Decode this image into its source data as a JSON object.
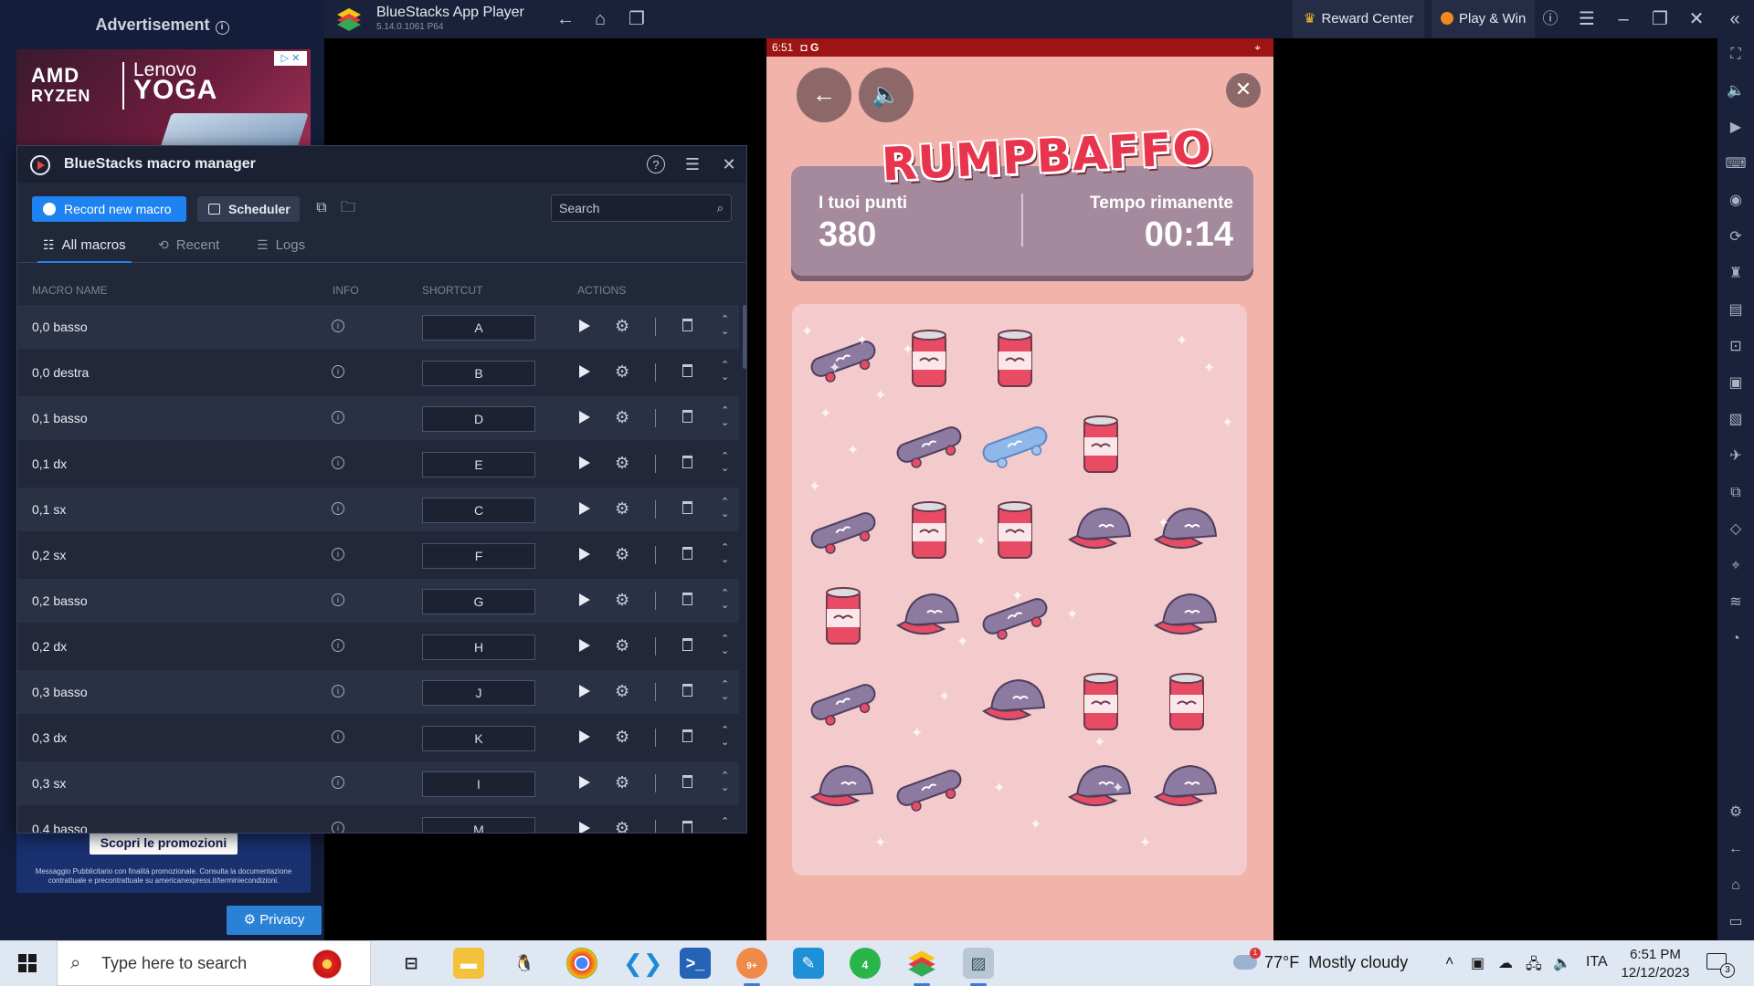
{
  "ad": {
    "header": "Advertisement",
    "info_glyph": "i",
    "banner_brand_1": "AMD",
    "banner_brand_1b": "RYZEN",
    "banner_brand_2": "Lenovo",
    "banner_brand_2b": "YOGA",
    "promo_button": "Scopri le promozioni",
    "promo_disclaimer": "Messaggio Pubblicitario con finalità promozionale. Consulta la documentazione contrattuale e precontrattuale su americanexpress.it/terminiecondizioni.",
    "privacy_button": "Privacy"
  },
  "app": {
    "title": "BlueStacks App Player",
    "version": "5.14.0.1061 P64",
    "reward_center": "Reward Center",
    "play_win": "Play & Win"
  },
  "macro_manager": {
    "title": "BlueStacks macro manager",
    "record_button": "Record new macro",
    "scheduler_button": "Scheduler",
    "search_placeholder": "Search",
    "tabs": [
      {
        "label": "All macros",
        "icon": "list-icon",
        "active": true
      },
      {
        "label": "Recent",
        "icon": "history-icon",
        "active": false
      },
      {
        "label": "Logs",
        "icon": "logs-icon",
        "active": false
      }
    ],
    "columns": {
      "name": "MACRO NAME",
      "info": "INFO",
      "shortcut": "SHORTCUT",
      "actions": "ACTIONS"
    },
    "rows": [
      {
        "name": "0,0 basso",
        "shortcut": "A"
      },
      {
        "name": "0,0 destra",
        "shortcut": "B"
      },
      {
        "name": "0,1 basso",
        "shortcut": "D"
      },
      {
        "name": "0,1 dx",
        "shortcut": "E"
      },
      {
        "name": "0,1 sx",
        "shortcut": "C"
      },
      {
        "name": "0,2  sx",
        "shortcut": "F"
      },
      {
        "name": "0,2 basso",
        "shortcut": "G"
      },
      {
        "name": "0,2 dx",
        "shortcut": "H"
      },
      {
        "name": "0,3 basso",
        "shortcut": "J"
      },
      {
        "name": "0,3 dx",
        "shortcut": "K"
      },
      {
        "name": "0,3 sx",
        "shortcut": "I"
      },
      {
        "name": "0,4 basso",
        "shortcut": "M"
      }
    ]
  },
  "game": {
    "status_time": "6:51",
    "status_icons": "◘ G",
    "logo_text": "RUMPBAFFO",
    "score_label": "I tuoi punti",
    "score_value": "380",
    "time_label": "Tempo rimanente",
    "time_value": "00:14",
    "grid": [
      [
        "skateboard",
        "can",
        "can",
        "empty",
        "empty"
      ],
      [
        "empty",
        "skateboard",
        "skateboard-selected",
        "can",
        "empty"
      ],
      [
        "skateboard",
        "can",
        "can",
        "cap",
        "cap"
      ],
      [
        "can",
        "cap",
        "skateboard",
        "empty",
        "cap"
      ],
      [
        "skateboard",
        "empty",
        "cap",
        "can",
        "can"
      ],
      [
        "cap",
        "skateboard",
        "empty",
        "cap",
        "cap"
      ]
    ]
  },
  "taskbar": {
    "search_placeholder": "Type here to search",
    "weather_temp": "77°F",
    "weather_desc": "Mostly cloudy",
    "weather_badge": "1",
    "language": "ITA",
    "time": "6:51 PM",
    "date": "12/12/2023",
    "notification_count": "3",
    "discord_badge": "9+",
    "whatsapp_badge": "4"
  }
}
